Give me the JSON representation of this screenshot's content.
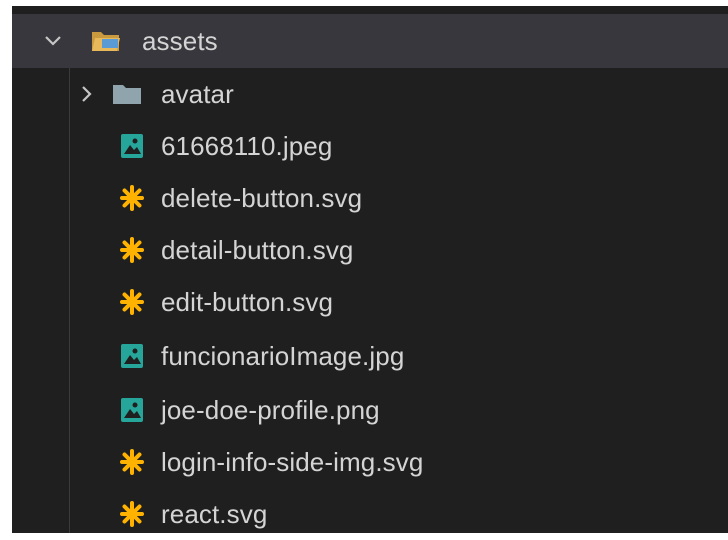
{
  "explorer": {
    "root_folder": {
      "name": "assets",
      "expanded": true,
      "icon": "folder-open-icon",
      "color": "#dcb167"
    },
    "subfolder": {
      "name": "avatar",
      "expanded": false,
      "icon": "folder-icon",
      "color": "#90a4ae"
    },
    "files": [
      {
        "name": "61668110.jpeg",
        "icon": "image-file-icon"
      },
      {
        "name": "delete-button.svg",
        "icon": "svg-file-icon"
      },
      {
        "name": "detail-button.svg",
        "icon": "svg-file-icon"
      },
      {
        "name": "edit-button.svg",
        "icon": "svg-file-icon"
      },
      {
        "name": "funcionarioImage.jpg",
        "icon": "image-file-icon"
      },
      {
        "name": "joe-doe-profile.png",
        "icon": "image-file-icon"
      },
      {
        "name": "login-info-side-img.svg",
        "icon": "svg-file-icon"
      },
      {
        "name": "react.svg",
        "icon": "svg-file-icon"
      }
    ],
    "colors": {
      "background": "#1f1f1f",
      "selected_row": "#37373d",
      "text": "#d4d4d4",
      "image_icon": "#26a69a",
      "svg_icon": "#ffb300"
    }
  }
}
